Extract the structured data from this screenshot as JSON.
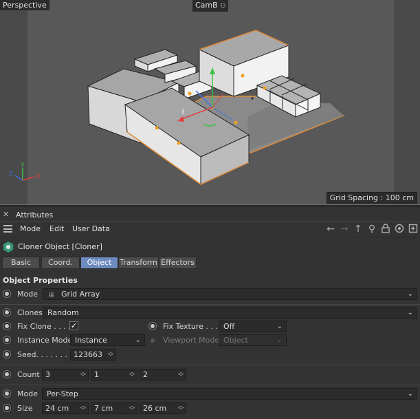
{
  "viewport": {
    "view_name": "Perspective",
    "camera_name": "CamB",
    "camera_icon": "camera-icon",
    "grid_spacing": "Grid Spacing : 100 cm",
    "axis_labels": {
      "x": "X",
      "y": "Y",
      "z": "Z"
    }
  },
  "attributes": {
    "title": "Attributes",
    "close_glyph": "✕",
    "menu": {
      "mode": "Mode",
      "edit": "Edit",
      "user_data": "User Data"
    },
    "toolbar_icons": [
      "back-arrow-icon",
      "forward-arrow-icon",
      "up-arrow-icon",
      "search-icon",
      "lock-icon",
      "target-icon",
      "new-panel-icon"
    ],
    "object_label": "Cloner Object [Cloner]",
    "tabs": [
      {
        "label": "Basic",
        "active": false
      },
      {
        "label": "Coord.",
        "active": false
      },
      {
        "label": "Object",
        "active": true
      },
      {
        "label": "Transform",
        "active": false
      },
      {
        "label": "Effectors",
        "active": false
      }
    ],
    "section_title": "Object Properties",
    "mode": {
      "label": "Mode",
      "value": "Grid Array"
    },
    "clones": {
      "label": "Clones",
      "value": "Random"
    },
    "fix_clone": {
      "label": "Fix Clone . . . .",
      "checked": true
    },
    "fix_texture": {
      "label": "Fix Texture . . .",
      "value": "Off"
    },
    "instance_mode": {
      "label": "Instance Mode",
      "value": "Instance"
    },
    "viewport_mode": {
      "label": "Viewport Mode",
      "value": "Object"
    },
    "seed": {
      "label": "Seed. . . . . . . .",
      "value": "123663"
    },
    "count": {
      "label": "Count",
      "values": [
        "3",
        "1",
        "2"
      ]
    },
    "size_mode": {
      "label": "Mode",
      "value": "Per-Step"
    },
    "size": {
      "label": "Size",
      "values": [
        "24 cm",
        "7 cm",
        "26 cm"
      ]
    }
  },
  "colors": {
    "accent_tab": "#6d8bbf",
    "selection_outline": "#e08a3c",
    "axis_x": "#e04040",
    "axis_y": "#40c040",
    "axis_z": "#4070e0"
  }
}
